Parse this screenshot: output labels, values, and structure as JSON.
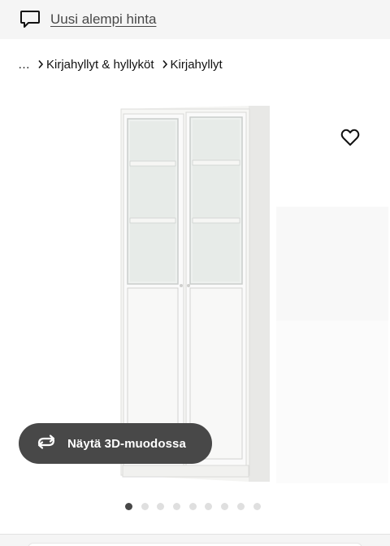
{
  "banner": {
    "icon": "speech-bubble-icon",
    "link_text": "Uusi alempi hinta"
  },
  "breadcrumb": {
    "items": [
      {
        "label": "…"
      },
      {
        "label": "Kirjahyllyt & hyllyköt"
      },
      {
        "label": "Kirjahyllyt"
      }
    ],
    "separator_icon": "chevron-right-icon"
  },
  "gallery": {
    "image": "white-bookcase-with-glass-doors",
    "favorite_icon": "heart-outline-icon",
    "view_3d_label": "Näytä 3D-muodossa",
    "view_3d_icon": "rotate-arrows-icon",
    "total_images": 9,
    "active_index": 0
  },
  "colors": {
    "banner_bg": "#f5f5f5",
    "button_dark": "#484848",
    "dot_inactive": "#dfdfdf",
    "text": "#111111"
  }
}
